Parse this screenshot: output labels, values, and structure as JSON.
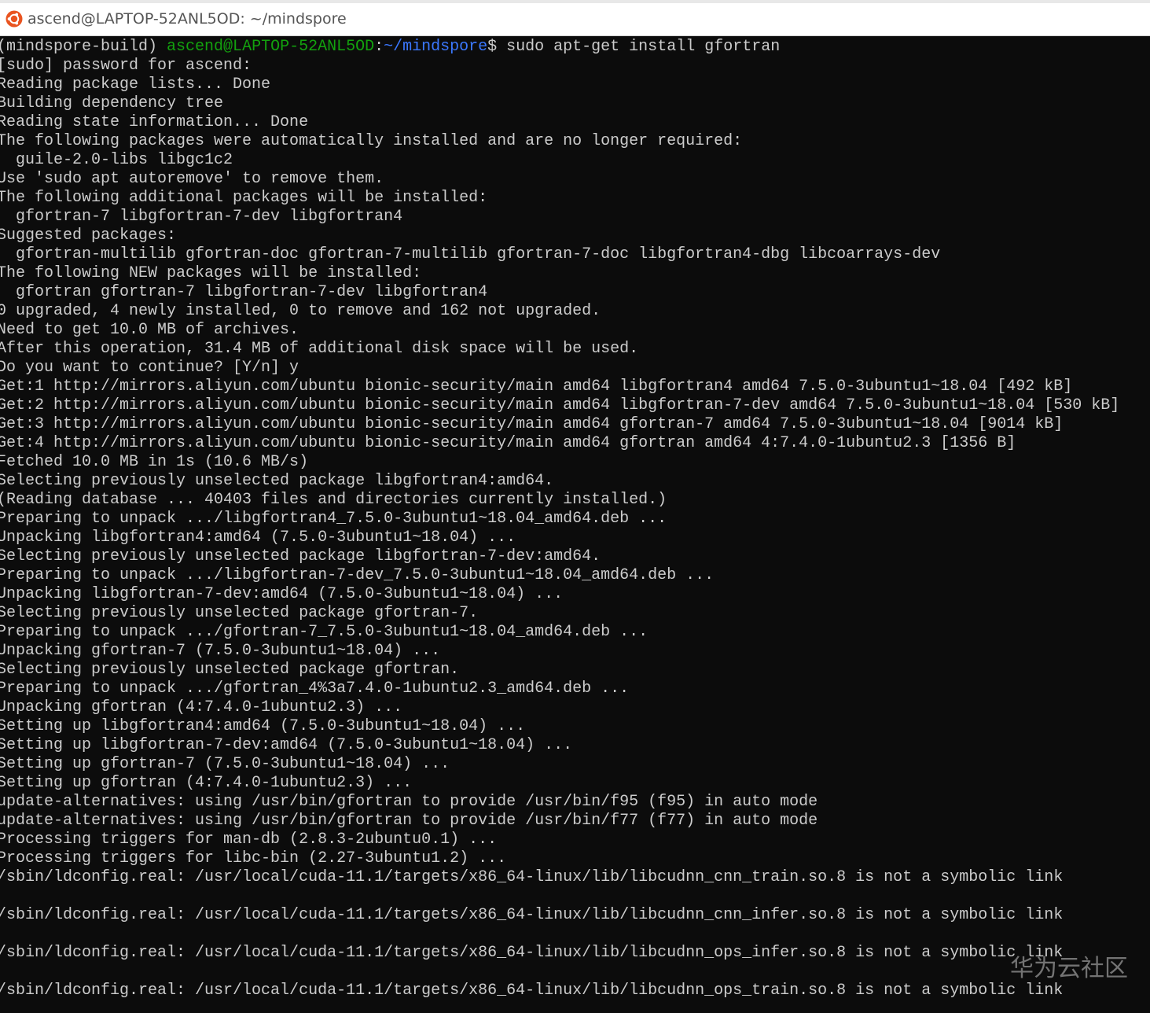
{
  "window": {
    "title": "ascend@LAPTOP-52ANL5OD: ~/mindspore",
    "icon": "ubuntu-icon"
  },
  "prompt": {
    "env": "(mindspore-build) ",
    "user_host": "ascend@LAPTOP-52ANL5OD",
    "sep": ":",
    "path": "~/mindspore",
    "dollar": "$ ",
    "command": "sudo apt-get install gfortran"
  },
  "output": [
    "[sudo] password for ascend:",
    "Reading package lists... Done",
    "Building dependency tree",
    "Reading state information... Done",
    "The following packages were automatically installed and are no longer required:",
    "  guile-2.0-libs libgc1c2",
    "Use 'sudo apt autoremove' to remove them.",
    "The following additional packages will be installed:",
    "  gfortran-7 libgfortran-7-dev libgfortran4",
    "Suggested packages:",
    "  gfortran-multilib gfortran-doc gfortran-7-multilib gfortran-7-doc libgfortran4-dbg libcoarrays-dev",
    "The following NEW packages will be installed:",
    "  gfortran gfortran-7 libgfortran-7-dev libgfortran4",
    "0 upgraded, 4 newly installed, 0 to remove and 162 not upgraded.",
    "Need to get 10.0 MB of archives.",
    "After this operation, 31.4 MB of additional disk space will be used.",
    "Do you want to continue? [Y/n] y",
    "Get:1 http://mirrors.aliyun.com/ubuntu bionic-security/main amd64 libgfortran4 amd64 7.5.0-3ubuntu1~18.04 [492 kB]",
    "Get:2 http://mirrors.aliyun.com/ubuntu bionic-security/main amd64 libgfortran-7-dev amd64 7.5.0-3ubuntu1~18.04 [530 kB]",
    "Get:3 http://mirrors.aliyun.com/ubuntu bionic-security/main amd64 gfortran-7 amd64 7.5.0-3ubuntu1~18.04 [9014 kB]",
    "Get:4 http://mirrors.aliyun.com/ubuntu bionic-security/main amd64 gfortran amd64 4:7.4.0-1ubuntu2.3 [1356 B]",
    "Fetched 10.0 MB in 1s (10.6 MB/s)",
    "Selecting previously unselected package libgfortran4:amd64.",
    "(Reading database ... 40403 files and directories currently installed.)",
    "Preparing to unpack .../libgfortran4_7.5.0-3ubuntu1~18.04_amd64.deb ...",
    "Unpacking libgfortran4:amd64 (7.5.0-3ubuntu1~18.04) ...",
    "Selecting previously unselected package libgfortran-7-dev:amd64.",
    "Preparing to unpack .../libgfortran-7-dev_7.5.0-3ubuntu1~18.04_amd64.deb ...",
    "Unpacking libgfortran-7-dev:amd64 (7.5.0-3ubuntu1~18.04) ...",
    "Selecting previously unselected package gfortran-7.",
    "Preparing to unpack .../gfortran-7_7.5.0-3ubuntu1~18.04_amd64.deb ...",
    "Unpacking gfortran-7 (7.5.0-3ubuntu1~18.04) ...",
    "Selecting previously unselected package gfortran.",
    "Preparing to unpack .../gfortran_4%3a7.4.0-1ubuntu2.3_amd64.deb ...",
    "Unpacking gfortran (4:7.4.0-1ubuntu2.3) ...",
    "Setting up libgfortran4:amd64 (7.5.0-3ubuntu1~18.04) ...",
    "Setting up libgfortran-7-dev:amd64 (7.5.0-3ubuntu1~18.04) ...",
    "Setting up gfortran-7 (7.5.0-3ubuntu1~18.04) ...",
    "Setting up gfortran (4:7.4.0-1ubuntu2.3) ...",
    "update-alternatives: using /usr/bin/gfortran to provide /usr/bin/f95 (f95) in auto mode",
    "update-alternatives: using /usr/bin/gfortran to provide /usr/bin/f77 (f77) in auto mode",
    "Processing triggers for man-db (2.8.3-2ubuntu0.1) ...",
    "Processing triggers for libc-bin (2.27-3ubuntu1.2) ...",
    "/sbin/ldconfig.real: /usr/local/cuda-11.1/targets/x86_64-linux/lib/libcudnn_cnn_train.so.8 is not a symbolic link",
    "",
    "/sbin/ldconfig.real: /usr/local/cuda-11.1/targets/x86_64-linux/lib/libcudnn_cnn_infer.so.8 is not a symbolic link",
    "",
    "/sbin/ldconfig.real: /usr/local/cuda-11.1/targets/x86_64-linux/lib/libcudnn_ops_infer.so.8 is not a symbolic link",
    "",
    "/sbin/ldconfig.real: /usr/local/cuda-11.1/targets/x86_64-linux/lib/libcudnn_ops_train.so.8 is not a symbolic link"
  ],
  "watermark": "华为云社区",
  "colors": {
    "background": "#0c0c0c",
    "text": "#cccccc",
    "prompt_user": "#13a10e",
    "prompt_path": "#3b78ff",
    "icon_orange": "#e95420"
  }
}
